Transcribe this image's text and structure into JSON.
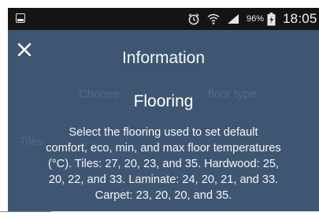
{
  "status_bar": {
    "battery_percent": "96%",
    "time": "18:05",
    "icons": [
      "gallery-icon",
      "alarm-clock-icon",
      "wifi-icon",
      "signal-icon",
      "battery-icon"
    ]
  },
  "dialog": {
    "title": "Information",
    "close_icon": "close-icon",
    "section_title": "Flooring",
    "body_lines": [
      "Select the flooring used to set default",
      "comfort, eco, min, and max floor temperatures",
      "(°C). Tiles: 27, 20, 23, and 35. Hardwood: 25,",
      "20, 22, and 33. Laminate: 24, 20, 21, and 33.",
      "Carpet: 23, 20, 20, and 35."
    ]
  },
  "background_text": {
    "choose_left": "Choose",
    "choose_right": "floor type",
    "tiles_fragment": "Tiles"
  },
  "colors": {
    "status_bar_bg": "#141414",
    "dialog_bg": "#3e5672",
    "text": "#ffffff"
  }
}
